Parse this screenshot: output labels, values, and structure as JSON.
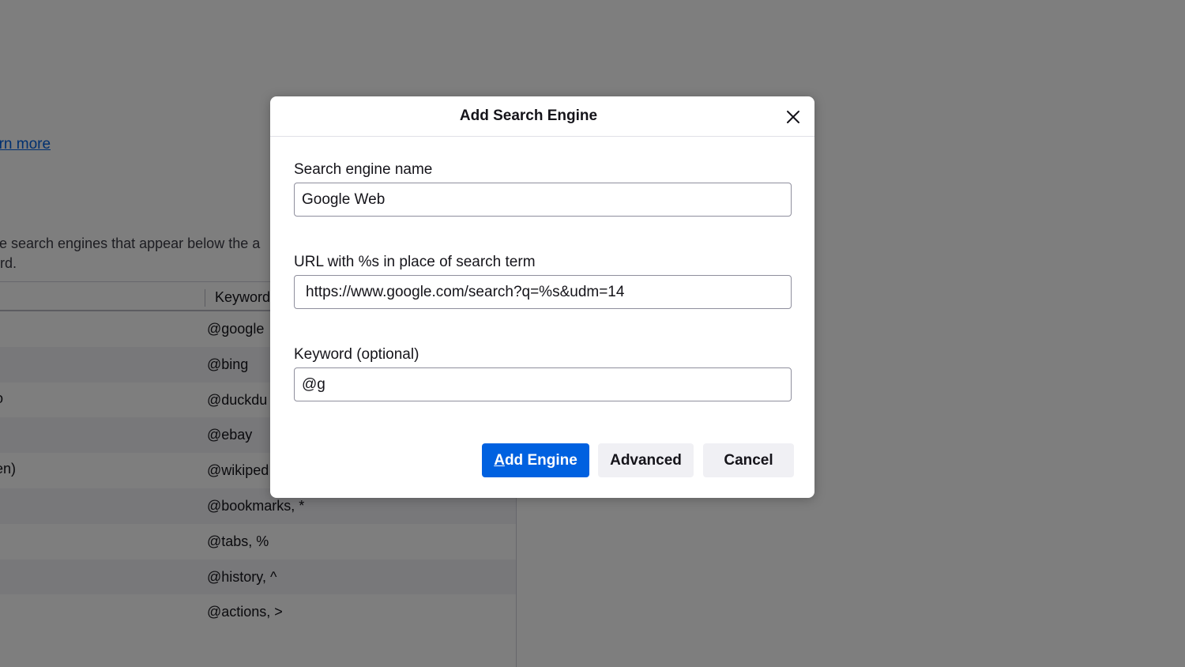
{
  "background": {
    "learn_more_link": "arn more",
    "description_line1": "ve search engines that appear below the a",
    "description_line2": "ord.",
    "table": {
      "keyword_header": "Keyword",
      "rows": [
        {
          "name": "",
          "keyword": "@google"
        },
        {
          "name": "",
          "keyword": "@bing"
        },
        {
          "name": "o",
          "keyword": "@duckdu"
        },
        {
          "name": "",
          "keyword": "@ebay"
        },
        {
          "name": "en)",
          "keyword": "@wikiped"
        },
        {
          "name": "",
          "keyword": "@bookmarks, *"
        },
        {
          "name": "",
          "keyword": "@tabs, %"
        },
        {
          "name": "",
          "keyword": "@history, ^"
        },
        {
          "name": "",
          "keyword": "@actions, >"
        }
      ]
    }
  },
  "dialog": {
    "title": "Add Search Engine",
    "close_icon": "close-icon",
    "name_field": {
      "label": "Search engine name",
      "value": "Google Web"
    },
    "url_field": {
      "label": "URL with %s in place of search term",
      "value": "https://www.google.com/search?q=%s&udm=14"
    },
    "keyword_field": {
      "label": "Keyword (optional)",
      "value": "@g"
    },
    "buttons": {
      "add_engine_key": "A",
      "add_engine_rest": "dd Engine",
      "advanced": "Advanced",
      "cancel": "Cancel"
    }
  },
  "colors": {
    "primary_button": "#0061e0",
    "link": "#0061e0",
    "overlay": "rgba(0,0,0,0.5)"
  }
}
